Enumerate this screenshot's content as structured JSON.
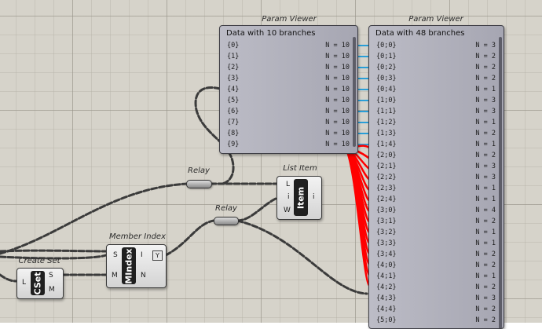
{
  "viewer1": {
    "title": "Param Viewer",
    "header": "Data with 10 branches",
    "rows": [
      {
        "path": "{0}",
        "count": "N = 10"
      },
      {
        "path": "{1}",
        "count": "N = 10"
      },
      {
        "path": "{2}",
        "count": "N = 10"
      },
      {
        "path": "{3}",
        "count": "N = 10"
      },
      {
        "path": "{4}",
        "count": "N = 10"
      },
      {
        "path": "{5}",
        "count": "N = 10"
      },
      {
        "path": "{6}",
        "count": "N = 10"
      },
      {
        "path": "{7}",
        "count": "N = 10"
      },
      {
        "path": "{8}",
        "count": "N = 10"
      },
      {
        "path": "{9}",
        "count": "N = 10"
      }
    ]
  },
  "viewer2": {
    "title": "Param Viewer",
    "header": "Data with 48 branches",
    "rows": [
      {
        "path": "{0;0}",
        "count": "N = 3"
      },
      {
        "path": "{0;1}",
        "count": "N = 2"
      },
      {
        "path": "{0;2}",
        "count": "N = 2"
      },
      {
        "path": "{0;3}",
        "count": "N = 2"
      },
      {
        "path": "{0;4}",
        "count": "N = 1"
      },
      {
        "path": "{1;0}",
        "count": "N = 3"
      },
      {
        "path": "{1;1}",
        "count": "N = 3"
      },
      {
        "path": "{1;2}",
        "count": "N = 1"
      },
      {
        "path": "{1;3}",
        "count": "N = 2"
      },
      {
        "path": "{1;4}",
        "count": "N = 1"
      },
      {
        "path": "{2;0}",
        "count": "N = 2"
      },
      {
        "path": "{2;1}",
        "count": "N = 3"
      },
      {
        "path": "{2;2}",
        "count": "N = 3"
      },
      {
        "path": "{2;3}",
        "count": "N = 1"
      },
      {
        "path": "{2;4}",
        "count": "N = 1"
      },
      {
        "path": "{3;0}",
        "count": "N = 4"
      },
      {
        "path": "{3;1}",
        "count": "N = 2"
      },
      {
        "path": "{3;2}",
        "count": "N = 1"
      },
      {
        "path": "{3;3}",
        "count": "N = 1"
      },
      {
        "path": "{3;4}",
        "count": "N = 2"
      },
      {
        "path": "{4;0}",
        "count": "N = 2"
      },
      {
        "path": "{4;1}",
        "count": "N = 1"
      },
      {
        "path": "{4;2}",
        "count": "N = 2"
      },
      {
        "path": "{4;3}",
        "count": "N = 3"
      },
      {
        "path": "{4;4}",
        "count": "N = 2"
      },
      {
        "path": "{5;0}",
        "count": "N = 2"
      }
    ]
  },
  "list_item": {
    "title": "List Item",
    "core": "Item",
    "inputs": [
      "L",
      "i",
      "W"
    ],
    "output": "i"
  },
  "relay1": {
    "title": "Relay"
  },
  "relay2": {
    "title": "Relay"
  },
  "member_index": {
    "title": "Member Index",
    "core": "MIndex",
    "inputs": [
      "S",
      "M"
    ],
    "outputs": [
      "I",
      "N"
    ],
    "filter_icon": "Y"
  },
  "create_set": {
    "title": "Create Set",
    "core": "CSet",
    "inputs": [
      "L"
    ],
    "outputs": [
      "S",
      "M"
    ]
  },
  "colors": {
    "canvas": "#d6d3ca",
    "highlight_wire": "#ff0000",
    "selected_wire": "#2a9fd8",
    "wire": "#3b3b3b"
  }
}
